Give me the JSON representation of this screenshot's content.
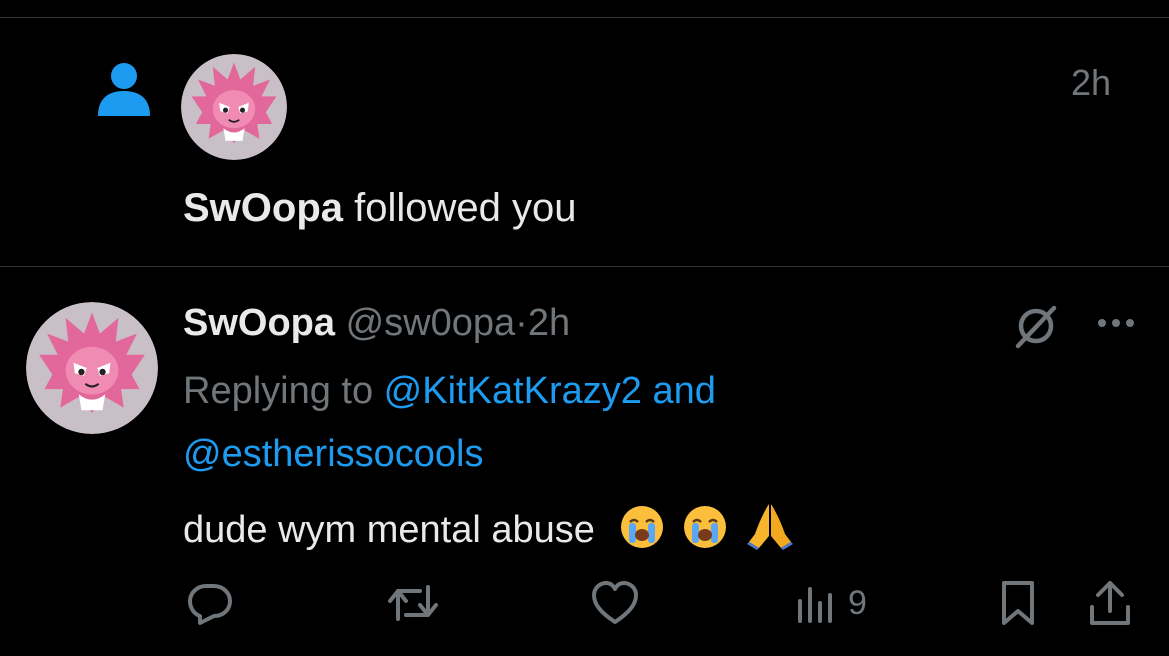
{
  "follow_notification": {
    "icon": "person-icon",
    "time": "2h",
    "user_name": "SwOopa",
    "action_text": " followed you"
  },
  "tweet": {
    "display_name": "SwOopa",
    "handle": "@sw0opa",
    "separator": "·",
    "time": "2h",
    "replying_prefix": "Replying to ",
    "mention_1": "@KitKatKrazy2",
    "mention_joiner": " and",
    "mention_2": "@estherissocools",
    "text": "dude wym mental abuse",
    "emojis": [
      "loudly-crying-face-icon",
      "loudly-crying-face-icon",
      "folded-hands-icon"
    ],
    "actions": {
      "reply_icon": "reply-icon",
      "retweet_icon": "retweet-icon",
      "like_icon": "heart-icon",
      "views_icon": "views-icon",
      "views_count": "9",
      "bookmark_icon": "bookmark-icon",
      "share_icon": "share-icon"
    }
  },
  "colors": {
    "background": "#000000",
    "text": "#e7e9ea",
    "muted": "#71767b",
    "link": "#1d9bf0",
    "follow_icon": "#1d9bf0",
    "divider": "#2f3336"
  }
}
